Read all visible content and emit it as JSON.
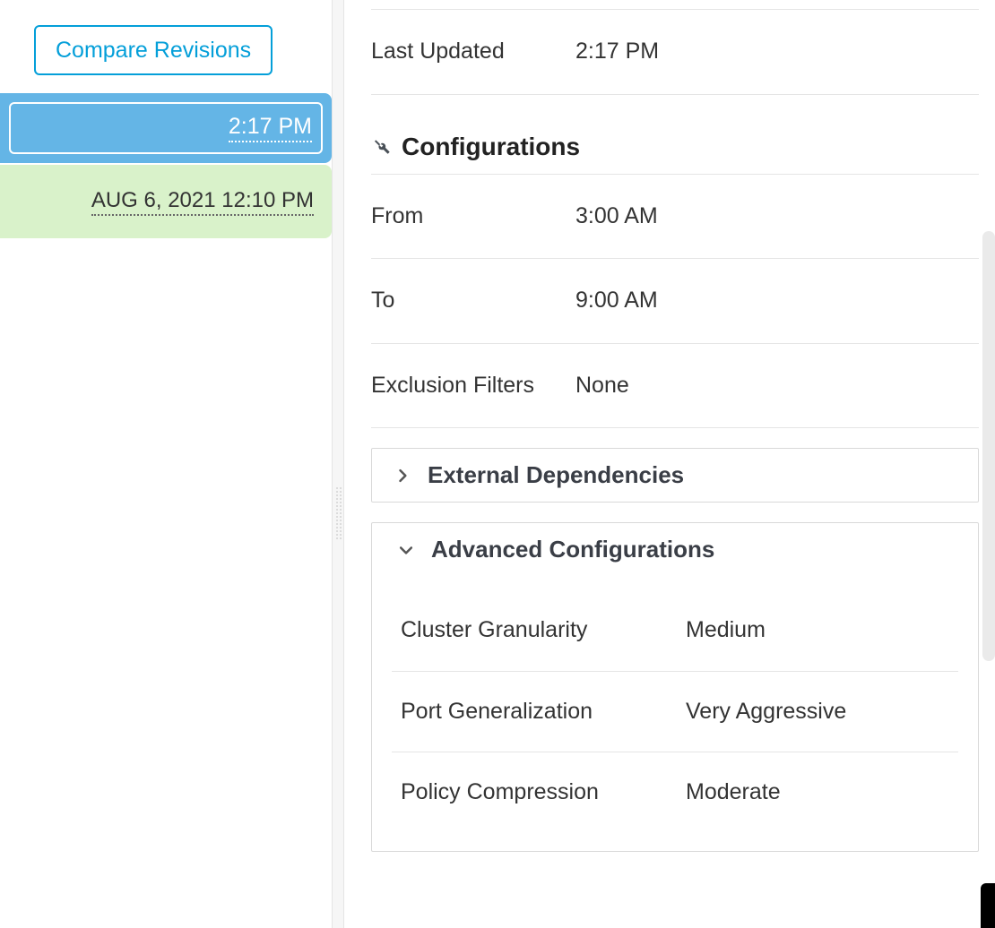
{
  "sidebar": {
    "compare_label": "Compare Revisions",
    "revisions": [
      {
        "label": "2:17 PM",
        "selected": true
      },
      {
        "label": "AUG 6, 2021 12:10 PM",
        "selected": false
      }
    ]
  },
  "details": {
    "last_updated_label": "Last Updated",
    "last_updated_value": "2:17 PM"
  },
  "configurations": {
    "title": "Configurations",
    "rows": [
      {
        "label": "From",
        "value": "3:00 AM"
      },
      {
        "label": "To",
        "value": "9:00 AM"
      },
      {
        "label": "Exclusion Filters",
        "value": "None"
      }
    ]
  },
  "panels": {
    "external_dependencies": {
      "title": "External Dependencies",
      "expanded": false
    },
    "advanced_configurations": {
      "title": "Advanced Configurations",
      "expanded": true,
      "rows": [
        {
          "label": "Cluster Granularity",
          "value": "Medium"
        },
        {
          "label": "Port Generalization",
          "value": "Very Aggressive"
        },
        {
          "label": "Policy Compression",
          "value": "Moderate"
        }
      ]
    }
  }
}
